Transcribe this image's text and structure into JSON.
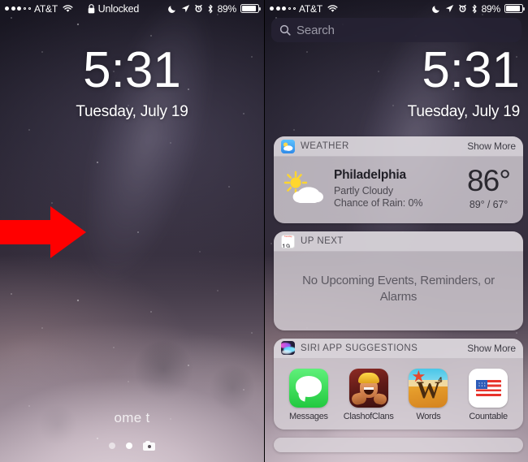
{
  "status_bar": {
    "signal_dots_filled": 3,
    "signal_dots_total": 5,
    "carrier": "AT&T",
    "wifi_icon": "wifi-icon",
    "lock_icon": "lock-icon",
    "lock_label": "Unlocked",
    "dnd_icon": "moon-icon",
    "location_icon": "location-arrow-icon",
    "alarm_icon": "alarm-clock-icon",
    "bluetooth_icon": "bluetooth-icon",
    "battery_percent": "89%",
    "battery_level": 89
  },
  "lock_screen": {
    "time": "5:31",
    "date": "Tuesday, July 19",
    "slide_hint": "ome t",
    "page_dots": 2,
    "active_dot_index": 1,
    "camera_icon": "camera-icon"
  },
  "annotation": {
    "arrow_icon": "red-right-arrow-icon",
    "arrow_color": "#FF0000",
    "direction": "right"
  },
  "search": {
    "icon": "search-icon",
    "placeholder": "Search",
    "value": ""
  },
  "widgets": [
    {
      "id": "weather",
      "icon": "weather-app-icon",
      "title": "WEATHER",
      "action_label": "Show More",
      "condition_icon": "sun-behind-cloud-icon",
      "city": "Philadelphia",
      "condition": "Partly Cloudy",
      "rain": "Chance of Rain: 0%",
      "temp": "86°",
      "high_low": "89° / 67°"
    },
    {
      "id": "up-next",
      "icon": "calendar-icon",
      "calendar_weekday": "Tuesday",
      "calendar_day": "19",
      "title": "UP NEXT",
      "body": "No Upcoming Events, Reminders, or Alarms"
    },
    {
      "id": "siri-app-suggestions",
      "icon": "siri-icon",
      "title": "SIRI APP SUGGESTIONS",
      "action_label": "Show More",
      "apps": [
        {
          "name": "Messages",
          "icon": "messages-app-icon"
        },
        {
          "name": "ClashofClans",
          "icon": "clash-of-clans-app-icon"
        },
        {
          "name": "Words",
          "icon": "words-with-friends-app-icon"
        },
        {
          "name": "Countable",
          "icon": "countable-app-icon"
        }
      ]
    }
  ],
  "colors": {
    "accent_red": "#FF0000",
    "widget_bg": "#D8D2D8",
    "search_bg": "#262234",
    "messages_green": "#22C93F"
  }
}
